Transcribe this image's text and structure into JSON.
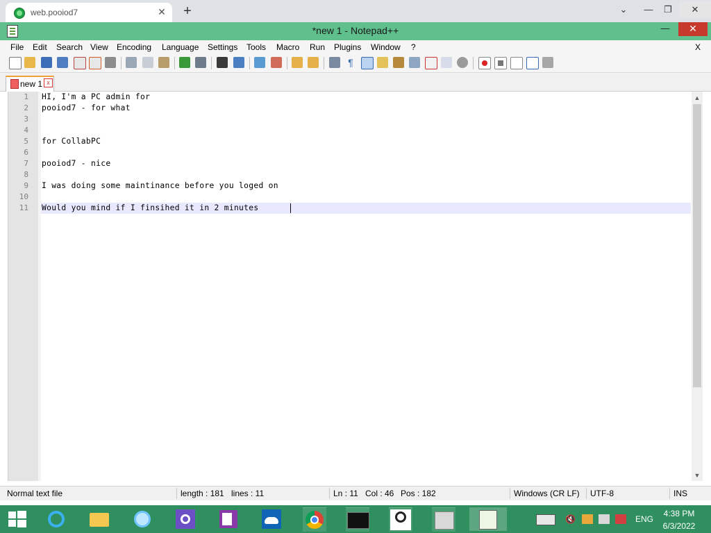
{
  "browser": {
    "tab_title": "web.pooiod7",
    "tab_close": "✕",
    "new_tab": "+",
    "chevron": "⌄",
    "minimize": "—",
    "restore": "❐",
    "close": "✕"
  },
  "window": {
    "title": "*new 1 - Notepad++",
    "minimize": "—",
    "maximize": "□",
    "close": "✕"
  },
  "menu": {
    "items": [
      "File",
      "Edit",
      "Search",
      "View",
      "Encoding",
      "Language",
      "Settings",
      "Tools",
      "Macro",
      "Run",
      "Plugins",
      "Window",
      "?"
    ],
    "close_doc": "X"
  },
  "toolbar": {
    "icons": [
      "new-file",
      "open-file",
      "save",
      "save-all",
      "close",
      "close-all",
      "print",
      "cut",
      "copy",
      "paste",
      "undo",
      "redo",
      "find",
      "replace",
      "zoom-in",
      "zoom-out",
      "sync-vertical",
      "sync-horizontal",
      "word-wrap",
      "show-all-chars",
      "indent-guide",
      "udl",
      "doc-map",
      "function-list",
      "folder-workspace",
      "monitoring",
      "record-macro",
      "stop-macro",
      "play-macro",
      "run-macro-multiple",
      "save-macro"
    ]
  },
  "doc_tab": {
    "label": "new 1",
    "close": "x"
  },
  "editor": {
    "line_numbers": [
      "1",
      "2",
      "3",
      "4",
      "5",
      "6",
      "7",
      "8",
      "9",
      "10",
      "11"
    ],
    "lines": [
      "HI, I'm a PC admin for",
      "pooiod7 - for what",
      "",
      "",
      "for CollabPC",
      "",
      "pooiod7 - nice",
      "",
      "I was doing some maintinance before you loged on",
      "",
      "Would you mind if I finsihed it in 2 minutes "
    ]
  },
  "scrollbar": {
    "up": "▲",
    "down": "▼"
  },
  "status": {
    "file_type": "Normal text file",
    "length": "length : 181",
    "lines": "lines : 11",
    "ln": "Ln : 11",
    "col": "Col : 46",
    "pos": "Pos : 182",
    "eol": "Windows (CR LF)",
    "encoding": "UTF-8",
    "mode": "INS"
  },
  "tray": {
    "lang": "ENG",
    "time": "4:38 PM",
    "date": "6/3/2022"
  },
  "colors": {
    "title_bar": "#5fbf8d",
    "taskbar": "#2f8f5f",
    "close_red": "#c7382d",
    "current_line": "#e8e8ff"
  }
}
